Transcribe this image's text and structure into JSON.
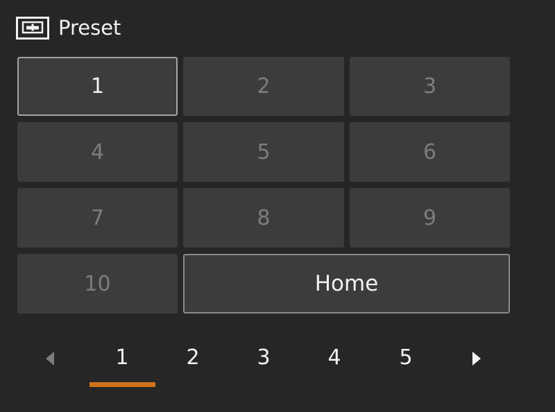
{
  "header": {
    "title": "Preset",
    "icon": "preset-monitor-icon"
  },
  "presets": [
    {
      "label": "1",
      "active": true
    },
    {
      "label": "2",
      "active": false
    },
    {
      "label": "3",
      "active": false
    },
    {
      "label": "4",
      "active": false
    },
    {
      "label": "5",
      "active": false
    },
    {
      "label": "6",
      "active": false
    },
    {
      "label": "7",
      "active": false
    },
    {
      "label": "8",
      "active": false
    },
    {
      "label": "9",
      "active": false
    },
    {
      "label": "10",
      "active": false
    }
  ],
  "home_label": "Home",
  "pager": {
    "pages": [
      "1",
      "2",
      "3",
      "4",
      "5"
    ],
    "selected": "1",
    "prev_icon": "triangle-left-icon",
    "next_icon": "triangle-right-icon"
  },
  "colors": {
    "background": "#262626",
    "button": "#3c3c3c",
    "text_active": "#f2f2f2",
    "text_dim": "#7d7d7d",
    "accent": "#d2711b"
  }
}
